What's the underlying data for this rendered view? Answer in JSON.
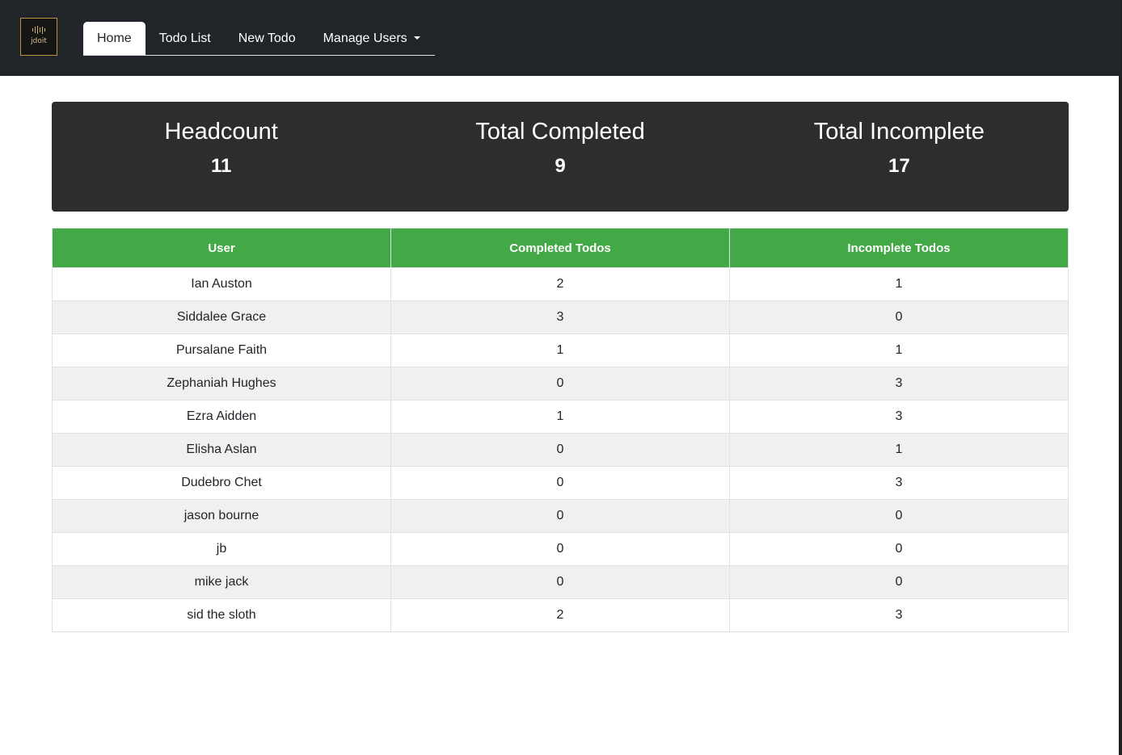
{
  "logo": {
    "text": "jdoit"
  },
  "nav": {
    "tabs": [
      {
        "label": "Home",
        "active": true
      },
      {
        "label": "Todo List"
      },
      {
        "label": "New Todo"
      },
      {
        "label": "Manage Users"
      }
    ]
  },
  "stats": {
    "headcount": {
      "label": "Headcount",
      "value": "11"
    },
    "completed": {
      "label": "Total Completed",
      "value": "9"
    },
    "incomplete": {
      "label": "Total Incomplete",
      "value": "17"
    }
  },
  "table": {
    "headers": [
      "User",
      "Completed Todos",
      "Incomplete Todos"
    ],
    "rows": [
      {
        "user": "Ian Auston",
        "completed": "2",
        "incomplete": "1"
      },
      {
        "user": "Siddalee Grace",
        "completed": "3",
        "incomplete": "0"
      },
      {
        "user": "Pursalane Faith",
        "completed": "1",
        "incomplete": "1"
      },
      {
        "user": "Zephaniah Hughes",
        "completed": "0",
        "incomplete": "3"
      },
      {
        "user": "Ezra Aidden",
        "completed": "1",
        "incomplete": "3"
      },
      {
        "user": "Elisha Aslan",
        "completed": "0",
        "incomplete": "1"
      },
      {
        "user": "Dudebro Chet",
        "completed": "0",
        "incomplete": "3"
      },
      {
        "user": "jason bourne",
        "completed": "0",
        "incomplete": "0"
      },
      {
        "user": "jb",
        "completed": "0",
        "incomplete": "0"
      },
      {
        "user": "mike jack",
        "completed": "0",
        "incomplete": "0"
      },
      {
        "user": "sid the sloth",
        "completed": "2",
        "incomplete": "3"
      }
    ]
  },
  "colors": {
    "navbar": "#212529",
    "stats_panel": "#2d2d2d",
    "table_header": "#43a846",
    "logo_gold": "#b8943b"
  }
}
